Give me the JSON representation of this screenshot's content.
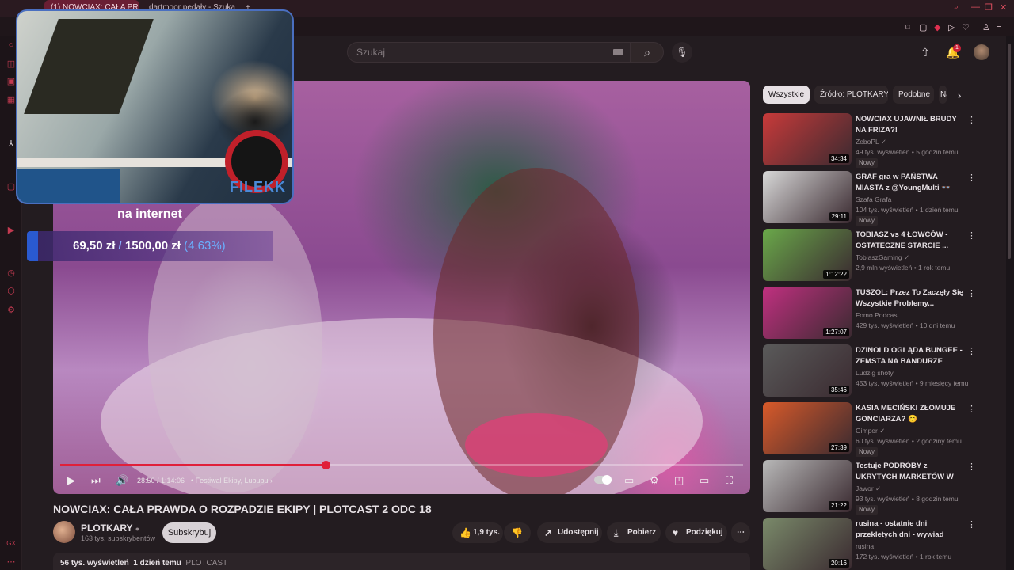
{
  "browser": {
    "tabs": [
      {
        "label": "(1) NOWCIAX: CAŁA PRA"
      },
      {
        "label": "dartmoor pedały - Szuka"
      }
    ],
    "new_tab": "+"
  },
  "search": {
    "placeholder": "Szukaj"
  },
  "notifications": {
    "count": "1"
  },
  "overlay": {
    "webcam_label": "FILEKK",
    "caption": "na internet",
    "donation_current": "69,50 zł",
    "donation_sep": "/",
    "donation_goal": "1500,00 zł",
    "donation_pct": "(4.63%)",
    "donation_progress": 0.0463
  },
  "player": {
    "time": "28:50 / 1:14:06",
    "chapter": "• Festiwal Ekipy, Lububu ›",
    "progress": 0.389
  },
  "video": {
    "title": "NOWCIAX: CAŁA PRAWDA O ROZPADZIE EKIPY | PLOTCAST 2 ODC 18",
    "channel": "PLOTKARY",
    "subscribers": "163 tys. subskrybentów",
    "subscribe_label": "Subskrybuj",
    "likes": "1,9 tys.",
    "share_label": "Udostępnij",
    "download_label": "Pobierz",
    "thanks_label": "Podziękuj",
    "views": "56 tys. wyświetleń",
    "date": "1 dzień temu",
    "tag": "PLOTCAST"
  },
  "chips": [
    "Wszystkie",
    "Źródło: PLOTKARY",
    "Podobne",
    "Na"
  ],
  "recommendations": [
    {
      "title": "NOWCIAX UJAWNIŁ BRUDY NA FRIZA?!",
      "channel": "ZeboPL ✓",
      "meta": "49 tys. wyświetleń • 5 godzin temu",
      "badge": "Nowy",
      "duration": "34:34",
      "thumb_color": "#c83a3a"
    },
    {
      "title": "GRAF gra w PAŃSTWA MIASTA z @YoungMulti 👓",
      "channel": "Szafa Grafa",
      "meta": "104 tys. wyświetleń • 1 dzień temu",
      "badge": "Nowy",
      "duration": "29:11",
      "thumb_color": "#d8d8d8"
    },
    {
      "title": "TOBIASZ vs 4 ŁOWCÓW - OSTATECZNE STARCIE ...",
      "channel": "TobiaszGaming ✓",
      "meta": "2,9 mln wyświetleń • 1 rok temu",
      "badge": "",
      "duration": "1:12:22",
      "thumb_color": "#6aa84a"
    },
    {
      "title": "TUSZOL: Przez To Zaczęły Się Wszystkie Problemy...",
      "channel": "Fomo Podcast",
      "meta": "429 tys. wyświetleń • 10 dni temu",
      "badge": "",
      "duration": "1:27:07",
      "thumb_color": "#c03080"
    },
    {
      "title": "DZINOLD OGLĄDA BUNGEE - ZEMSTA NA BANDURZE",
      "channel": "Ludzig shoty",
      "meta": "453 tys. wyświetleń • 9 miesięcy temu",
      "badge": "",
      "duration": "35:46",
      "thumb_color": "#5a5a5a"
    },
    {
      "title": "KASIA MECIŃSKI ZŁOMUJE GONCIARZA? 😊",
      "channel": "Gimper ✓",
      "meta": "60 tys. wyświetleń • 2 godziny temu",
      "badge": "Nowy",
      "duration": "27:39",
      "thumb_color": "#d85a2a"
    },
    {
      "title": "Testuje PODRÓBY z UKRYTYCH MARKETÓW W AZJI!",
      "channel": "Jawor ✓",
      "meta": "93 tys. wyświetleń • 8 godzin temu",
      "badge": "Nowy",
      "duration": "21:22",
      "thumb_color": "#b8b8b8"
    },
    {
      "title": "rusina - ostatnie dni przekletych dni - wywiad",
      "channel": "rusina",
      "meta": "172 tys. wyświetleń • 1 rok temu",
      "badge": "",
      "duration": "20:16",
      "thumb_color": "#7a8a6a"
    }
  ],
  "colors": {
    "accent": "#e0203a",
    "opera_red": "#c23a50"
  }
}
